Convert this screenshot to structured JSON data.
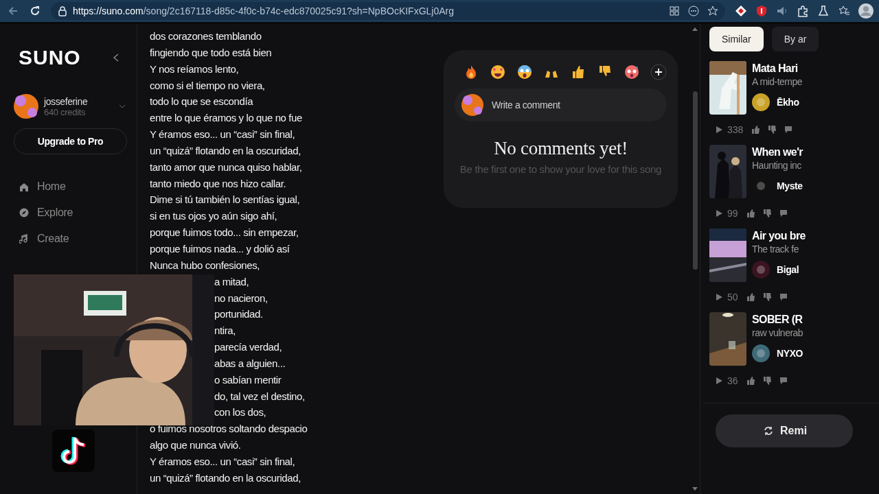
{
  "browser": {
    "url_host": "https://suno.com",
    "url_path": "/song/2c167118-d85c-4f0c-b74c-edc870025c91?sh=NpBOcKIFxGLj0Arg"
  },
  "sidebar": {
    "logo": "SUNO",
    "user": {
      "name": "josseferine",
      "credits": "640 credits"
    },
    "upgrade": "Upgrade to Pro",
    "items": [
      {
        "label": "Home"
      },
      {
        "label": "Explore"
      },
      {
        "label": "Create"
      }
    ]
  },
  "lyrics": [
    {
      "text": "dos corazones temblando",
      "covered": false
    },
    {
      "text": "fingiendo que todo está bien",
      "covered": false
    },
    {
      "text": "Y nos reíamos lento,",
      "covered": false
    },
    {
      "text": "como si el tiempo no viera,",
      "covered": false
    },
    {
      "text": "todo lo que se escondía",
      "covered": false
    },
    {
      "text": "entre lo que éramos y lo que no fue",
      "covered": false
    },
    {
      "text": "Y éramos eso... un “casi” sin final,",
      "covered": false
    },
    {
      "text": "un “quizá” flotando en la oscuridad,",
      "covered": false
    },
    {
      "text": "tanto amor que nunca quiso hablar,",
      "covered": false
    },
    {
      "text": "tanto miedo que nos hizo callar.",
      "covered": false
    },
    {
      "text": "Dime si tú también lo sentías igual,",
      "covered": false
    },
    {
      "text": "si en tus ojos yo aún sigo ahí,",
      "covered": false
    },
    {
      "text": "porque fuimos todo... sin empezar,",
      "covered": false
    },
    {
      "text": "porque fuimos nada... y dolió así",
      "covered": false
    },
    {
      "text": "Nunca hubo confesiones,",
      "covered": false
    },
    {
      "text": "a mitad,",
      "covered": true
    },
    {
      "text": "no nacieron,",
      "covered": true
    },
    {
      "text": "portunidad.",
      "covered": true
    },
    {
      "text": "ntira,",
      "covered": true
    },
    {
      "text": "parecía verdad,",
      "covered": true
    },
    {
      "text": "abas a alguien...",
      "covered": true
    },
    {
      "text": "o sabían mentir",
      "covered": true
    },
    {
      "text": "do, tal vez el destino,",
      "covered": true
    },
    {
      "text": "con los dos,",
      "covered": true
    },
    {
      "text": "o fuimos nosotros soltando despacio",
      "covered": false
    },
    {
      "text": "algo que nunca vivió.",
      "covered": false
    },
    {
      "text": "Y éramos eso... un “casi” sin final,",
      "covered": false
    },
    {
      "text": "un “quizá” flotando en la oscuridad,",
      "covered": false
    }
  ],
  "comments": {
    "placeholder": "Write a comment",
    "empty_title": "No comments yet!",
    "empty_text": "Be the first one to show your love for this song"
  },
  "right_panel": {
    "tabs": [
      {
        "label": "Similar",
        "selected": true
      },
      {
        "label": "By ar",
        "selected": false
      }
    ],
    "songs": [
      {
        "title": "Mata Hari",
        "description": "A mid-tempe",
        "artist": "Ēkho",
        "plays": "338"
      },
      {
        "title": "When we'r",
        "description": "Haunting inc",
        "artist": "Myste",
        "plays": "99"
      },
      {
        "title": "Air you bre",
        "description": "The track fe",
        "artist": "Bigal",
        "plays": "50"
      },
      {
        "title": "SOBER (R",
        "description": "raw vulnerab",
        "artist": "NYXO",
        "plays": "36"
      }
    ],
    "remix": "Remi"
  }
}
